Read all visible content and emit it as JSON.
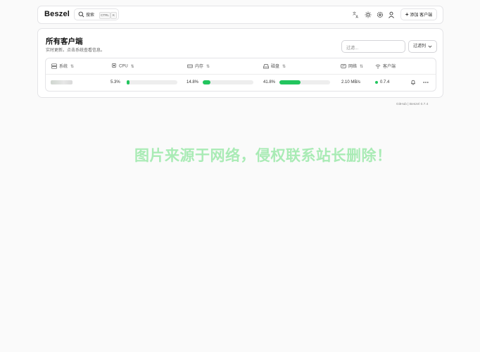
{
  "app": {
    "logo": "Beszel"
  },
  "search": {
    "label": "搜索",
    "shortcut_ctrl": "CTRL",
    "shortcut_key": "K"
  },
  "toolbar": {
    "add_label": "添加 客户端"
  },
  "card": {
    "title": "所有客户端",
    "subtitle": "实时更新。点击系统查看信息。",
    "filter_placeholder": "过滤...",
    "columns_label": "过滤列"
  },
  "table": {
    "headers": [
      "系统",
      "CPU",
      "内存",
      "磁盘",
      "网络",
      "客户端"
    ],
    "rows": [
      {
        "name": "",
        "cpu": "5.3%",
        "cpu_value": 5.3,
        "memory": "14.8%",
        "memory_value": 14.8,
        "disk": "41.8%",
        "disk_value": 41.8,
        "network": "2.10 MB/s",
        "agent": "0.7.4"
      }
    ]
  },
  "footer": {
    "github": "GitHub",
    "separator": "|",
    "version": "Beszel 0.7.4"
  },
  "watermark": "图片来源于网络，侵权联系站长删除！",
  "colors": {
    "accent": "#22c55e",
    "watermark": "#96e8a5"
  }
}
